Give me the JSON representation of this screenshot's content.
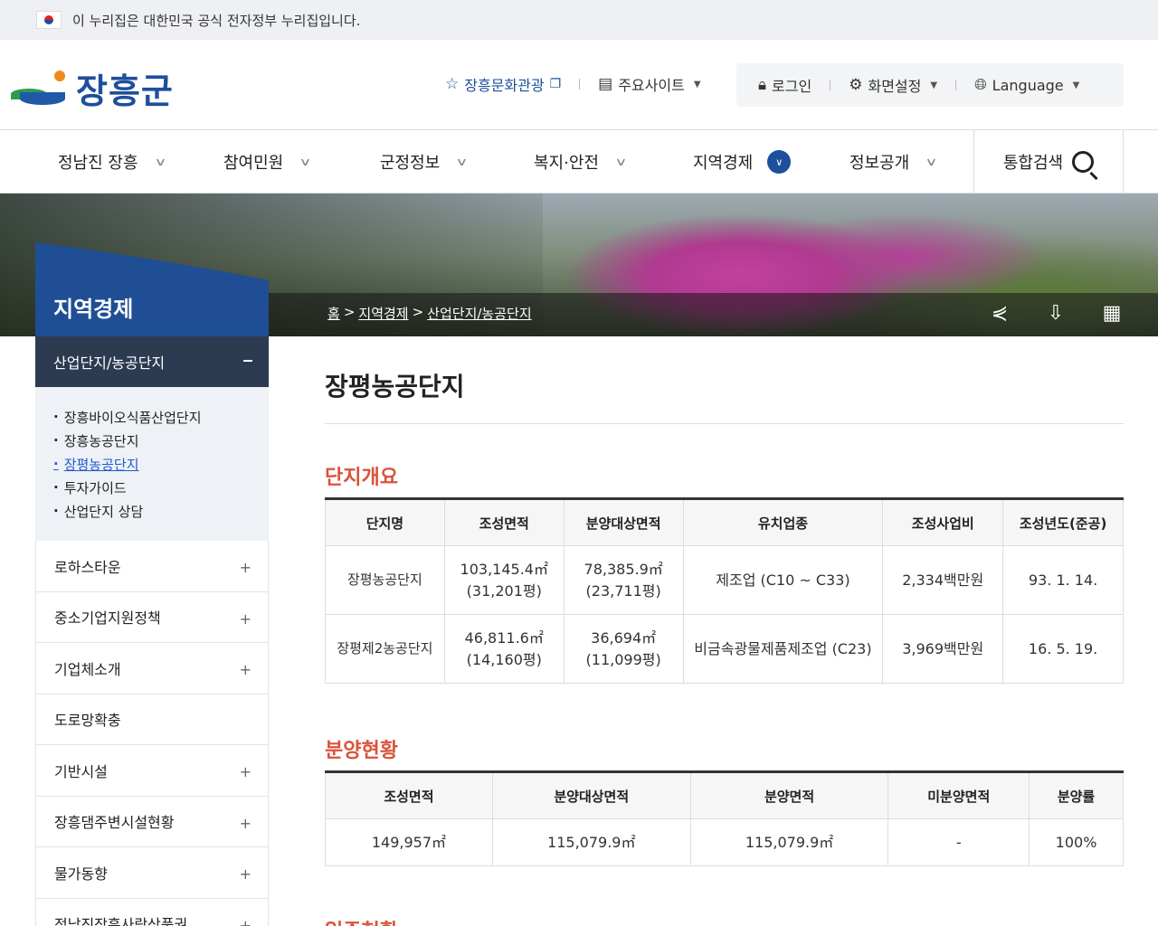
{
  "gov_banner": {
    "text": "이 누리집은 대한민국 공식 전자정부 누리집입니다."
  },
  "logo": {
    "text": "장흥군"
  },
  "utility": {
    "tour_label": "장흥문화관광",
    "sites_label": "주요사이트",
    "login_label": "로그인",
    "display_label": "화면설정",
    "language_label": "Language"
  },
  "gnb": {
    "items": [
      {
        "label": "정남진 장흥"
      },
      {
        "label": "참여민원"
      },
      {
        "label": "군정정보"
      },
      {
        "label": "복지·안전"
      },
      {
        "label": "지역경제"
      },
      {
        "label": "정보공개"
      }
    ],
    "search_label": "통합검색"
  },
  "breadcrumb": {
    "home": "홈",
    "level1": "지역경제",
    "level2": "산업단지/농공단지",
    "sep": ">"
  },
  "sidebar": {
    "title": "지역경제",
    "active": "산업단지/농공단지",
    "sub_items": [
      "장흥바이오식품산업단지",
      "장흥농공단지",
      "장평농공단지",
      "투자가이드",
      "산업단지 상담"
    ],
    "items": [
      {
        "label": "로하스타운",
        "has_sub": true
      },
      {
        "label": "중소기업지원정책",
        "has_sub": true
      },
      {
        "label": "기업체소개",
        "has_sub": true
      },
      {
        "label": "도로망확충",
        "has_sub": false
      },
      {
        "label": "기반시설",
        "has_sub": true
      },
      {
        "label": "장흥댐주변시설현황",
        "has_sub": true
      },
      {
        "label": "물가동향",
        "has_sub": true
      },
      {
        "label": "정남진장흥사랑상품권",
        "has_sub": true
      }
    ]
  },
  "main": {
    "title": "장평농공단지",
    "overview": {
      "title": "단지개요",
      "headers": [
        "단지명",
        "조성면적",
        "분양대상면적",
        "유치업종",
        "조성사업비",
        "조성년도(준공)"
      ],
      "rows": [
        {
          "name": "장평농공단지",
          "area": "103,145.4㎡",
          "area_py": "(31,201평)",
          "sale_area": "78,385.9㎡",
          "sale_py": "(23,711평)",
          "industry": "제조업 (C10 ~ C33)",
          "cost": "2,334백만원",
          "year": "93. 1. 14."
        },
        {
          "name": "장평제2농공단지",
          "area": "46,811.6㎡",
          "area_py": "(14,160평)",
          "sale_area": "36,694㎡",
          "sale_py": "(11,099평)",
          "industry": "비금속광물제품제조업 (C23)",
          "cost": "3,969백만원",
          "year": "16. 5. 19."
        }
      ]
    },
    "sales": {
      "title": "분양현황",
      "headers": [
        "조성면적",
        "분양대상면적",
        "분양면적",
        "미분양면적",
        "분양률"
      ],
      "row": [
        "149,957㎡",
        "115,079.9㎡",
        "115,079.9㎡",
        "-",
        "100%"
      ]
    },
    "next_section": "입주현황"
  }
}
